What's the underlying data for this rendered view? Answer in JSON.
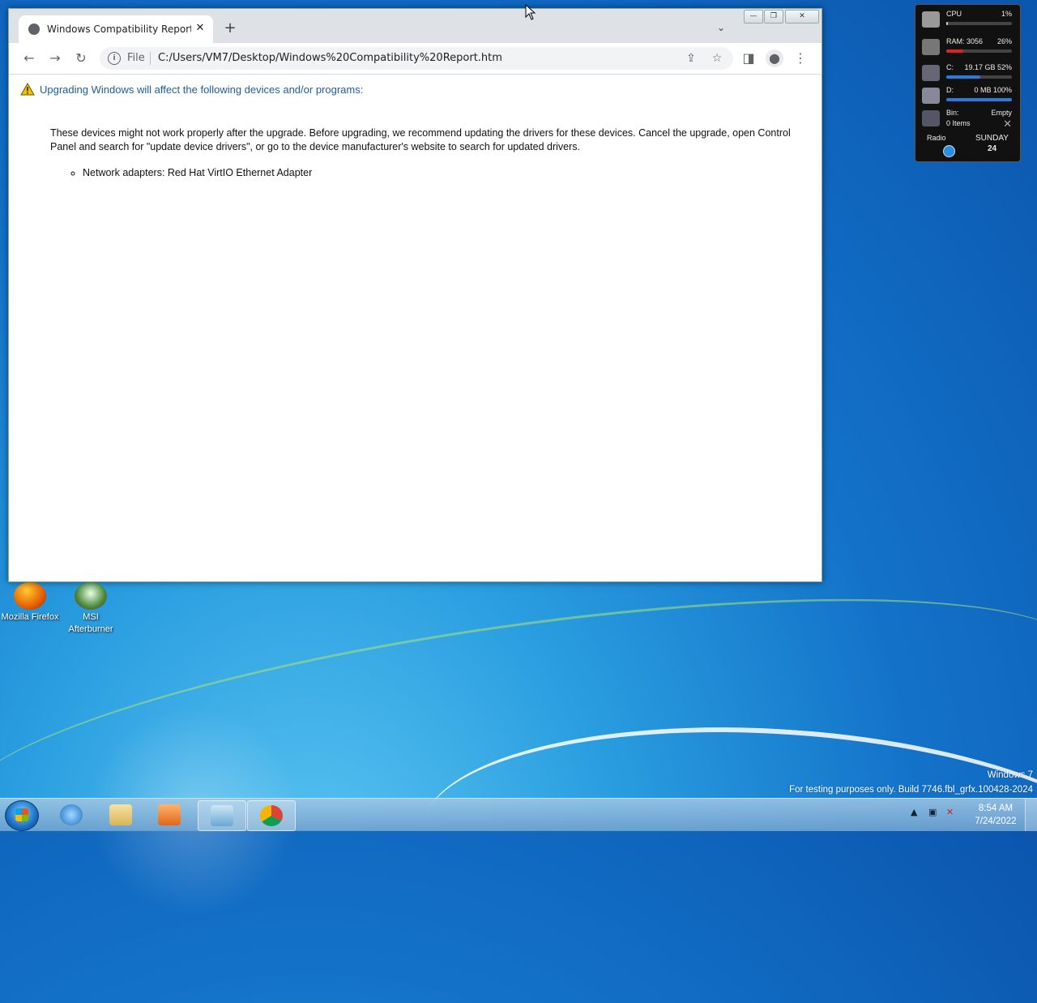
{
  "desktop": {
    "icons": [
      {
        "label": "Mozilla Firefox"
      },
      {
        "label": "MSI Afterburner"
      }
    ],
    "watermark": {
      "line1": "Windows 7",
      "line2": "For testing purposes only. Build 7746.fbl_grfx.100428-2024"
    }
  },
  "gadget": {
    "cpu": {
      "label": "CPU",
      "value": "1%",
      "fill": 0.01
    },
    "ram": {
      "label": "RAM: 3056",
      "value": "26%",
      "fill": 0.26
    },
    "drive_c": {
      "label": "C:",
      "value": "19.17 GB 52%",
      "fill": 0.52
    },
    "drive_d": {
      "label": "D:",
      "value": "0 MB 100%",
      "fill": 1.0
    },
    "bin": {
      "label": "Bin:",
      "status": "Empty",
      "items": "0 Items"
    },
    "radio": {
      "label": "Radio"
    },
    "calendar": {
      "day": "SUNDAY",
      "date": "24"
    }
  },
  "browser": {
    "tab": {
      "title": "Windows Compatibility Report.htm"
    },
    "toolbar": {
      "file_label": "File",
      "url": "C:/Users/VM7/Desktop/Windows%20Compatibility%20Report.htm"
    },
    "page": {
      "heading": "Upgrading Windows will affect the following devices and/or programs:",
      "paragraph": "These devices might not work properly after the upgrade. Before upgrading, we recommend updating the drivers for these devices. Cancel the upgrade, open Control Panel and search for \"update device drivers\", or go to the device manufacturer's website to search for updated drivers.",
      "items": [
        "Network adapters: Red Hat VirtIO Ethernet Adapter"
      ]
    }
  },
  "taskbar": {
    "clock": {
      "time": "8:54 AM",
      "date": "7/24/2022"
    }
  },
  "colors": {
    "heading": "#1f5c99",
    "warning": "#f2c200"
  }
}
